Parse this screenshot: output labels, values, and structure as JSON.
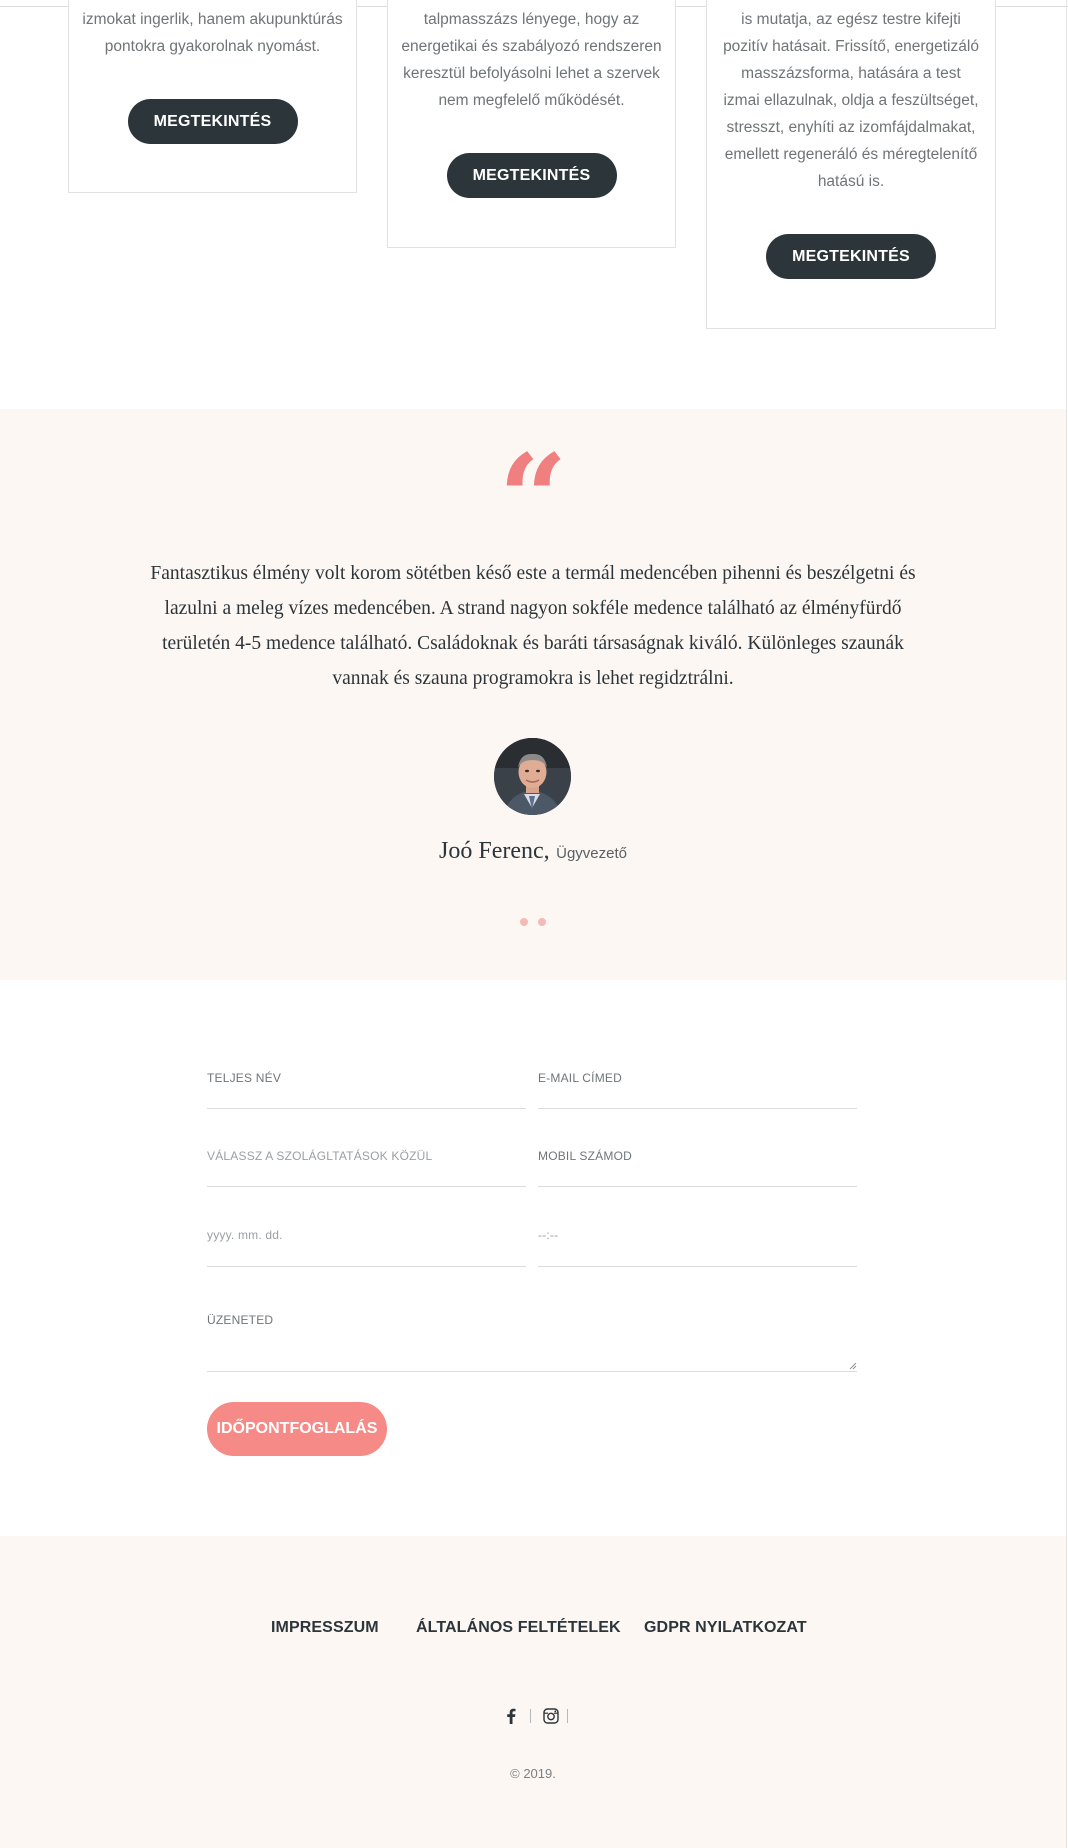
{
  "services": [
    {
      "text_lines": [
        "izmokat ingerlik, hanem akupunktúrás",
        "pontokra gyakorolnak nyomást."
      ],
      "button_label": "MEGTEKINTÉS"
    },
    {
      "text_lines": [
        "talpmasszázs lényege, hogy az",
        "energetikai és szabályozó rendszeren",
        "keresztül befolyásolni lehet a szervek",
        "nem megfelelő működését."
      ],
      "button_label": "MEGTEKINTÉS"
    },
    {
      "text_lines": [
        "is mutatja, az egész testre kifejti",
        "pozitív hatásait. Frissítő, energetizáló",
        "masszázsforma, hatására a test",
        "izmai ellazulnak, oldja a feszültséget,",
        "stresszt, enyhíti az izomfájdalmakat,",
        "emellett regeneráló és méregtelenítő",
        "hatású is."
      ],
      "button_label": "MEGTEKINTÉS"
    }
  ],
  "testimonial": {
    "quote_mark": "“",
    "text": "Fantasztikus élmény volt korom sötétben késő este a termál medencében pihenni és beszélgetni és lazulni a meleg vízes medencében. A strand nagyon sokféle medence található az élményfürdő területén 4-5 medence található. Családoknak és baráti társaságnak kiváló. Különleges szaunák vannak és szauna programokra is lehet regidztrálni.",
    "author_name": "Joó Ferenc,",
    "author_role": "Ügyvezető",
    "slides": 2,
    "accent": "#f07f7f",
    "background": "#fdf7f4"
  },
  "form": {
    "full_name_label": "TELJES NÉV",
    "email_label": "E-MAIL CÍMED",
    "service_label": "VÁLASSZ A SZOLÁGLTATÁSOK KÖZÜL",
    "phone_label": "MOBIL SZÁMOD",
    "date_placeholder": "yyyy. mm. dd.",
    "time_placeholder": "--:--",
    "message_label": "ÜZENETED",
    "submit_label": "IDŐPONTFOGLALÁS",
    "submit_color": "#f58a86"
  },
  "footer": {
    "links": [
      "IMPRESSZUM",
      "ÁLTALÁNOS FELTÉTELEK",
      "GDPR NYILATKOZAT"
    ],
    "social_icons": [
      "facebook-icon",
      "instagram-icon"
    ],
    "copyright": "© 2019."
  },
  "colors": {
    "dark_button": "#2c3539",
    "text_gray": "#6f7477"
  }
}
